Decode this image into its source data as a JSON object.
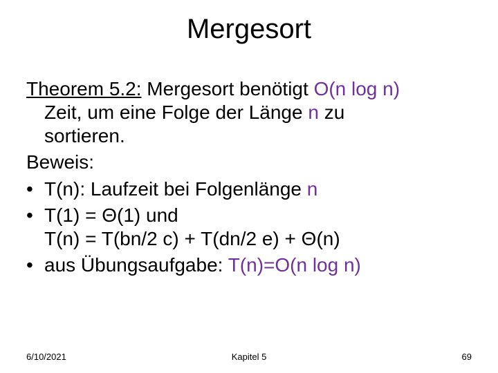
{
  "title": "Mergesort",
  "theorem": {
    "label": "Theorem 5.2:",
    "text_before_accent1": " Mergesort benötigt ",
    "accent1": "O(n log n)",
    "text_mid": " Zeit, um eine Folge der Länge ",
    "accent2": "n",
    "text_after": " zu sortieren."
  },
  "proof_label": "Beweis:",
  "bullets": [
    {
      "pre": "T(n): Laufzeit bei Folgenlänge ",
      "accent": "n",
      "post": ""
    },
    {
      "line1": "T(1) = Θ(1) und",
      "line2": "T(n) = T(bn/2 c) + T(dn/2 e) + Θ(n)"
    },
    {
      "pre": "aus Übungsaufgabe: ",
      "accent": "T(n)=O(n log n)",
      "post": ""
    }
  ],
  "footer": {
    "date": "6/10/2021",
    "chapter": "Kapitel 5",
    "page": "69"
  }
}
